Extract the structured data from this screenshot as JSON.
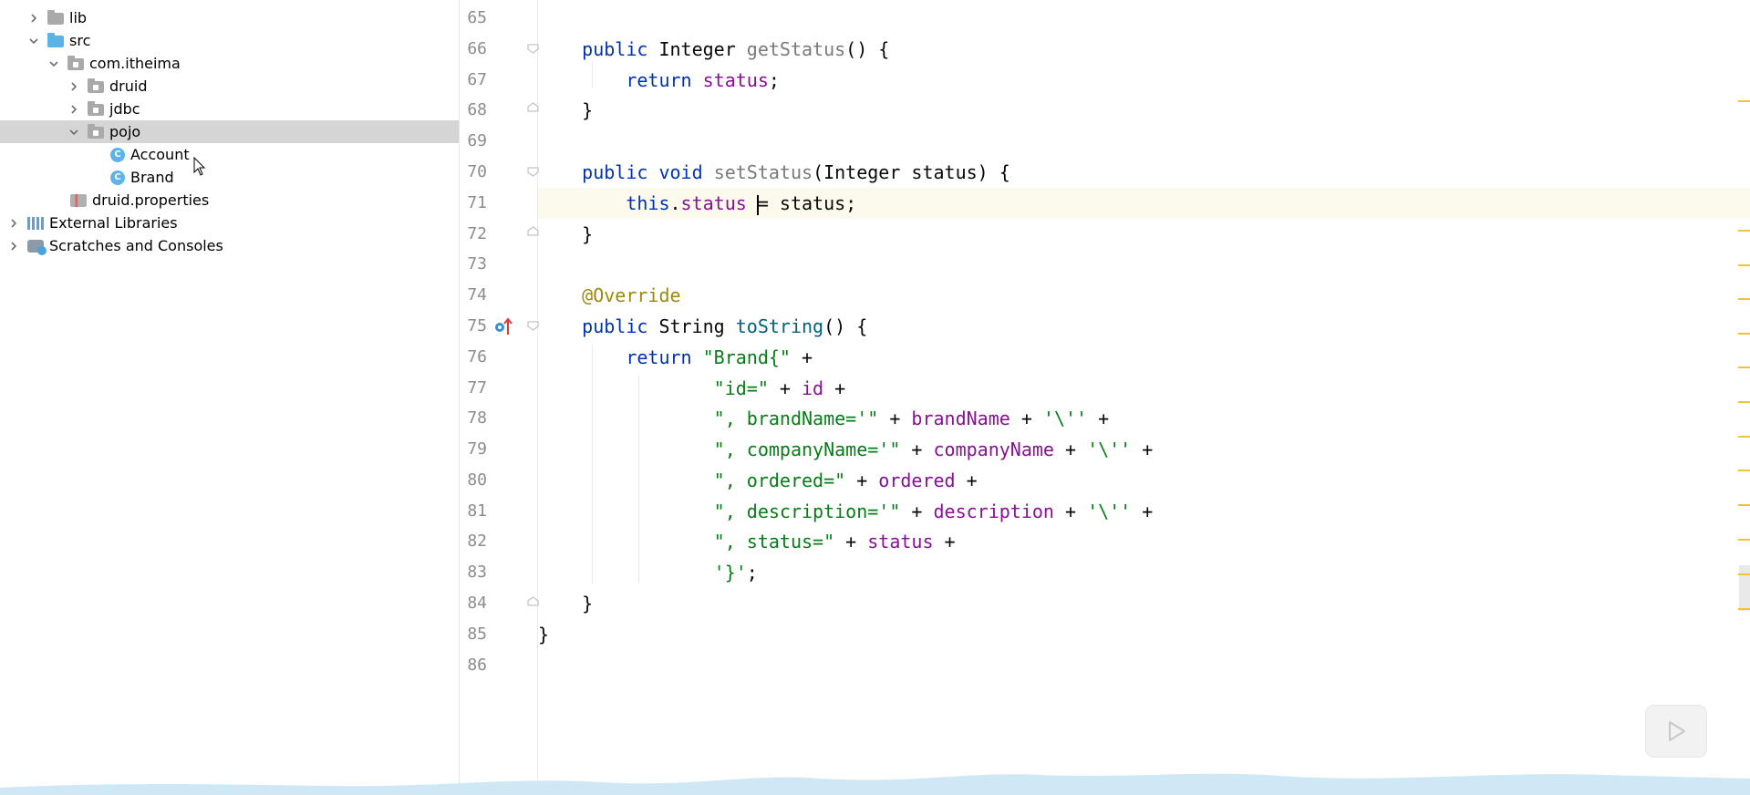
{
  "tree": {
    "items": [
      {
        "label": "lib",
        "icon": "folder-icon",
        "expanded": false
      },
      {
        "label": "src",
        "icon": "source-folder-icon",
        "expanded": true
      },
      {
        "label": "com.itheima",
        "icon": "package-icon",
        "expanded": true
      },
      {
        "label": "druid",
        "icon": "package-icon",
        "expanded": false
      },
      {
        "label": "jdbc",
        "icon": "package-icon",
        "expanded": false
      },
      {
        "label": "pojo",
        "icon": "package-icon",
        "expanded": true,
        "selected": true
      },
      {
        "label": "Account",
        "icon": "class-icon"
      },
      {
        "label": "Brand",
        "icon": "class-icon"
      },
      {
        "label": "druid.properties",
        "icon": "properties-file-icon"
      },
      {
        "label": "External Libraries",
        "icon": "libraries-icon",
        "expanded": false
      },
      {
        "label": "Scratches and Consoles",
        "icon": "scratches-icon",
        "expanded": false
      }
    ],
    "class_icon_letter": "C"
  },
  "editor": {
    "line_numbers": [
      "65",
      "66",
      "67",
      "68",
      "69",
      "70",
      "71",
      "72",
      "73",
      "74",
      "75",
      "76",
      "77",
      "78",
      "79",
      "80",
      "81",
      "82",
      "83",
      "84",
      "85",
      "86"
    ],
    "caret_line": "71"
  },
  "colors": {
    "keyword": "#0033b3",
    "field": "#871094",
    "string": "#067d17",
    "annotation": "#9e880d",
    "selection": "#d5d5d5",
    "warning_marker": "#f2c23a"
  }
}
